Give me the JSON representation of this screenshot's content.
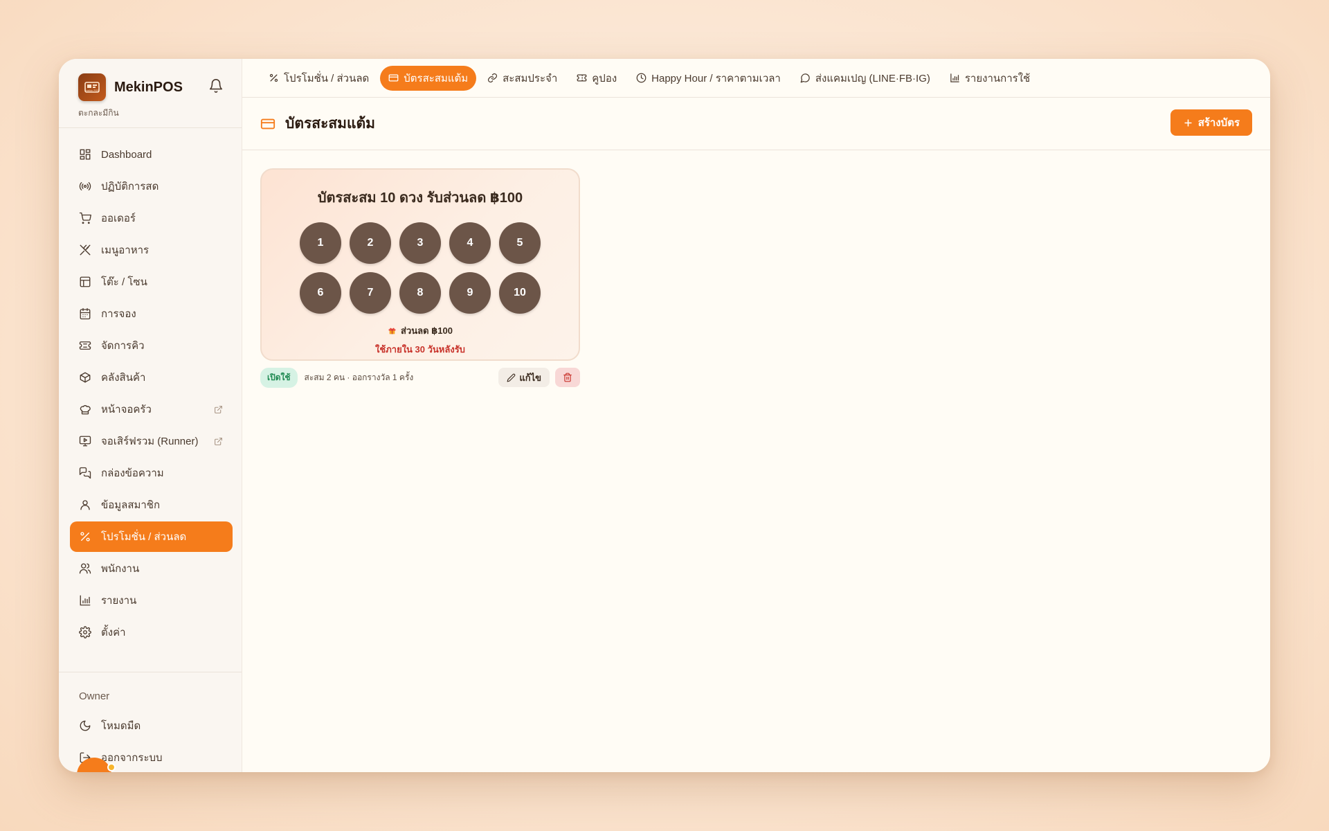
{
  "brand": {
    "name": "MekinPOS",
    "subtitle": "ตะกละมีกิน"
  },
  "sidebar": {
    "items": [
      {
        "label": "Dashboard",
        "icon": "dashboard-icon"
      },
      {
        "label": "ปฏิบัติการสด",
        "icon": "broadcast-icon"
      },
      {
        "label": "ออเดอร์",
        "icon": "cart-icon"
      },
      {
        "label": "เมนูอาหาร",
        "icon": "utensils-icon"
      },
      {
        "label": "โต๊ะ / โซน",
        "icon": "table-icon"
      },
      {
        "label": "การจอง",
        "icon": "calendar-icon"
      },
      {
        "label": "จัดการคิว",
        "icon": "ticket-icon"
      },
      {
        "label": "คลังสินค้า",
        "icon": "box-icon"
      },
      {
        "label": "หน้าจอครัว",
        "icon": "chef-hat-icon"
      },
      {
        "label": "จอเสิร์ฟรวม (Runner)",
        "icon": "monitor-icon"
      },
      {
        "label": "กล่องข้อความ",
        "icon": "messages-icon"
      },
      {
        "label": "ข้อมูลสมาชิก",
        "icon": "user-icon"
      },
      {
        "label": "โปรโมชั่น / ส่วนลด",
        "icon": "percent-icon"
      },
      {
        "label": "พนักงาน",
        "icon": "users-icon"
      },
      {
        "label": "รายงาน",
        "icon": "bar-chart-icon"
      },
      {
        "label": "ตั้งค่า",
        "icon": "gear-icon"
      }
    ],
    "active_index": 12,
    "role": "Owner",
    "dark_mode_label": "โหมดมืด",
    "logout_label": "ออกจากระบบ"
  },
  "tabs": [
    {
      "label": "โปรโมชั่น / ส่วนลด",
      "icon": "percent-icon"
    },
    {
      "label": "บัตรสะสมแต้ม",
      "icon": "card-icon"
    },
    {
      "label": "สะสมประจำ",
      "icon": "link-icon"
    },
    {
      "label": "คูปอง",
      "icon": "ticket-icon"
    },
    {
      "label": "Happy Hour / ราคาตามเวลา",
      "icon": "clock-icon"
    },
    {
      "label": "ส่งแคมเปญ (LINE·FB·IG)",
      "icon": "chat-icon"
    },
    {
      "label": "รายงานการใช้",
      "icon": "bar-chart-icon"
    }
  ],
  "active_tab": 1,
  "page": {
    "title": "บัตรสะสมแต้ม",
    "create_label": "สร้างบัตร"
  },
  "card": {
    "title": "บัตรสะสม 10 ดวง รับส่วนลด ฿100",
    "stamps": [
      "1",
      "2",
      "3",
      "4",
      "5",
      "6",
      "7",
      "8",
      "9",
      "10"
    ],
    "reward": "ส่วนลด ฿100",
    "expiry": "ใช้ภายใน 30 วันหลังรับ",
    "status": "เปิดใช้",
    "stats": "สะสม 2 คน · ออกรางวัล 1 ครั้ง",
    "edit_label": "แก้ไข"
  },
  "colors": {
    "accent": "#f57c1b",
    "stamp": "#6c5548",
    "danger": "#c8322a",
    "success": "#1f8a52"
  }
}
